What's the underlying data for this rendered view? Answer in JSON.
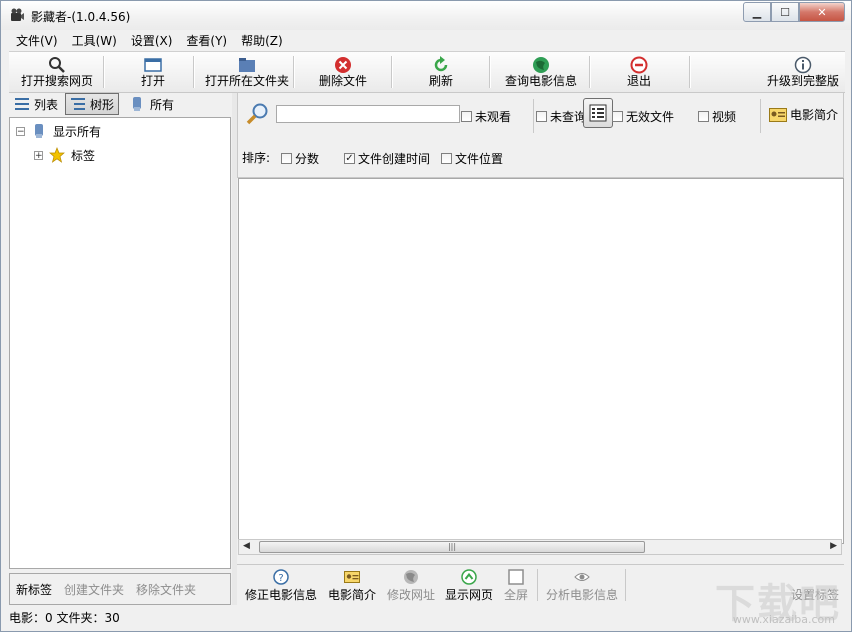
{
  "window": {
    "title": "影藏者-(1.0.4.56)"
  },
  "menu": [
    "文件(V)",
    "工具(W)",
    "设置(X)",
    "查看(Y)",
    "帮助(Z)"
  ],
  "toolbar": {
    "open_search": "打开搜索网页",
    "open": "打开",
    "open_folder": "打开所在文件夹",
    "delete_file": "删除文件",
    "refresh": "刷新",
    "query_movie": "查询电影信息",
    "exit": "退出",
    "upgrade": "升级到完整版"
  },
  "view_tabs": {
    "list": "列表",
    "tree": "树形",
    "all": "所有"
  },
  "tree": {
    "show_all": "显示所有",
    "tags": "标签"
  },
  "left_bottom": {
    "new_tag": "新标签",
    "create_folder": "创建文件夹",
    "remove_folder": "移除文件夹"
  },
  "filter": {
    "search_value": "",
    "unwatched": "未观看",
    "not_queried": "未查询",
    "invalid_file": "无效文件",
    "video": "视频",
    "movie_intro": "电影简介",
    "sort_label": "排序:",
    "sort_score": "分数",
    "sort_created": "文件创建时间",
    "sort_location": "文件位置",
    "sort_created_checked": true
  },
  "bottom_actions": {
    "fix_info": "修正电影信息",
    "intro": "电影简介",
    "edit_url": "修改网址",
    "show_web": "显示网页",
    "fullscreen": "全屏",
    "analyze": "分析电影信息",
    "set_tag": "设置标签"
  },
  "status": "电影：0 文件夹：30",
  "watermark": {
    "text": "下载吧",
    "url": "www.xiazaiba.com"
  },
  "colors": {
    "close_button": "#c65544",
    "tree_star": "#f2c200",
    "delete_red": "#d32f2f",
    "refresh_green": "#3aa64a"
  }
}
